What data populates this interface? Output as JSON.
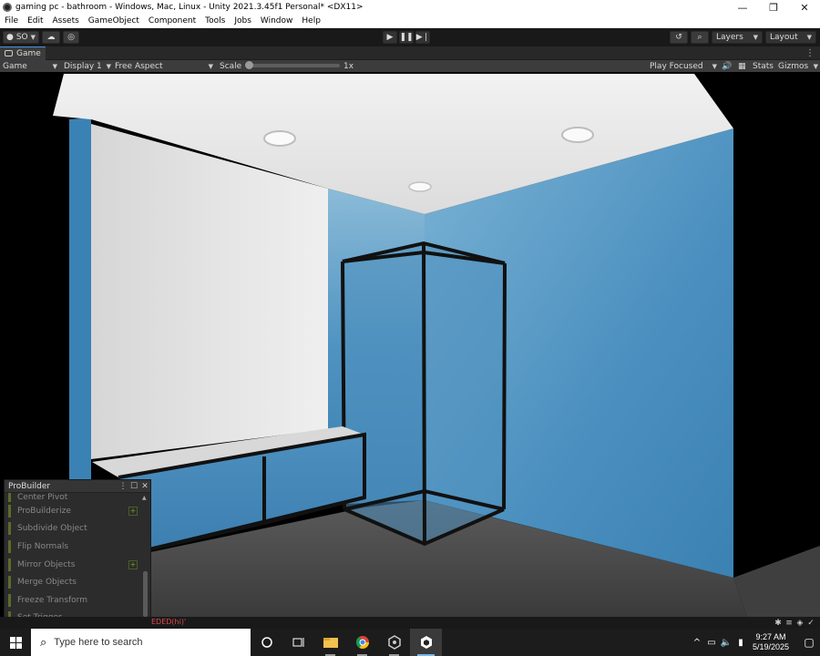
{
  "window": {
    "title": "gaming pc - bathroom - Windows, Mac, Linux - Unity 2021.3.45f1 Personal* <DX11>",
    "minimize": "—",
    "restore": "❐",
    "close": "✕"
  },
  "menu": [
    "File",
    "Edit",
    "Assets",
    "GameObject",
    "Component",
    "Tools",
    "Jobs",
    "Window",
    "Help"
  ],
  "toolbar": {
    "account_label": "SO",
    "layers_label": "Layers",
    "layout_label": "Layout"
  },
  "game_tab": {
    "label": "Game"
  },
  "game_bar": {
    "view_mode": "Game",
    "display": "Display 1",
    "aspect": "Free Aspect",
    "scale_label": "Scale",
    "scale_value": "1x",
    "scale_fraction": 0,
    "play_mode": "Play Focused",
    "stats": "Stats",
    "gizmos": "Gizmos"
  },
  "probuilder": {
    "title": "ProBuilder",
    "cut_item": "Center Pivot",
    "items": [
      {
        "label": "ProBuilderize",
        "has_options": true
      },
      {
        "label": "Subdivide Object",
        "has_options": false
      },
      {
        "label": "Flip Normals",
        "has_options": false
      },
      {
        "label": "Mirror Objects",
        "has_options": true
      },
      {
        "label": "Merge Objects",
        "has_options": false
      },
      {
        "label": "Freeze Transform",
        "has_options": false
      },
      {
        "label": "Set Trigger",
        "has_options": false
      }
    ]
  },
  "status": {
    "error_text": "EDED(hi)'"
  },
  "taskbar": {
    "search_placeholder": "Type here to search",
    "time": "9:27 AM",
    "date": "5/19/2025"
  },
  "colors": {
    "accent_blue": "#4a90e2",
    "wall_blue": "#3f86b5",
    "error_red": "#e04a4a",
    "taskbar_bg": "#1c1c1c"
  }
}
